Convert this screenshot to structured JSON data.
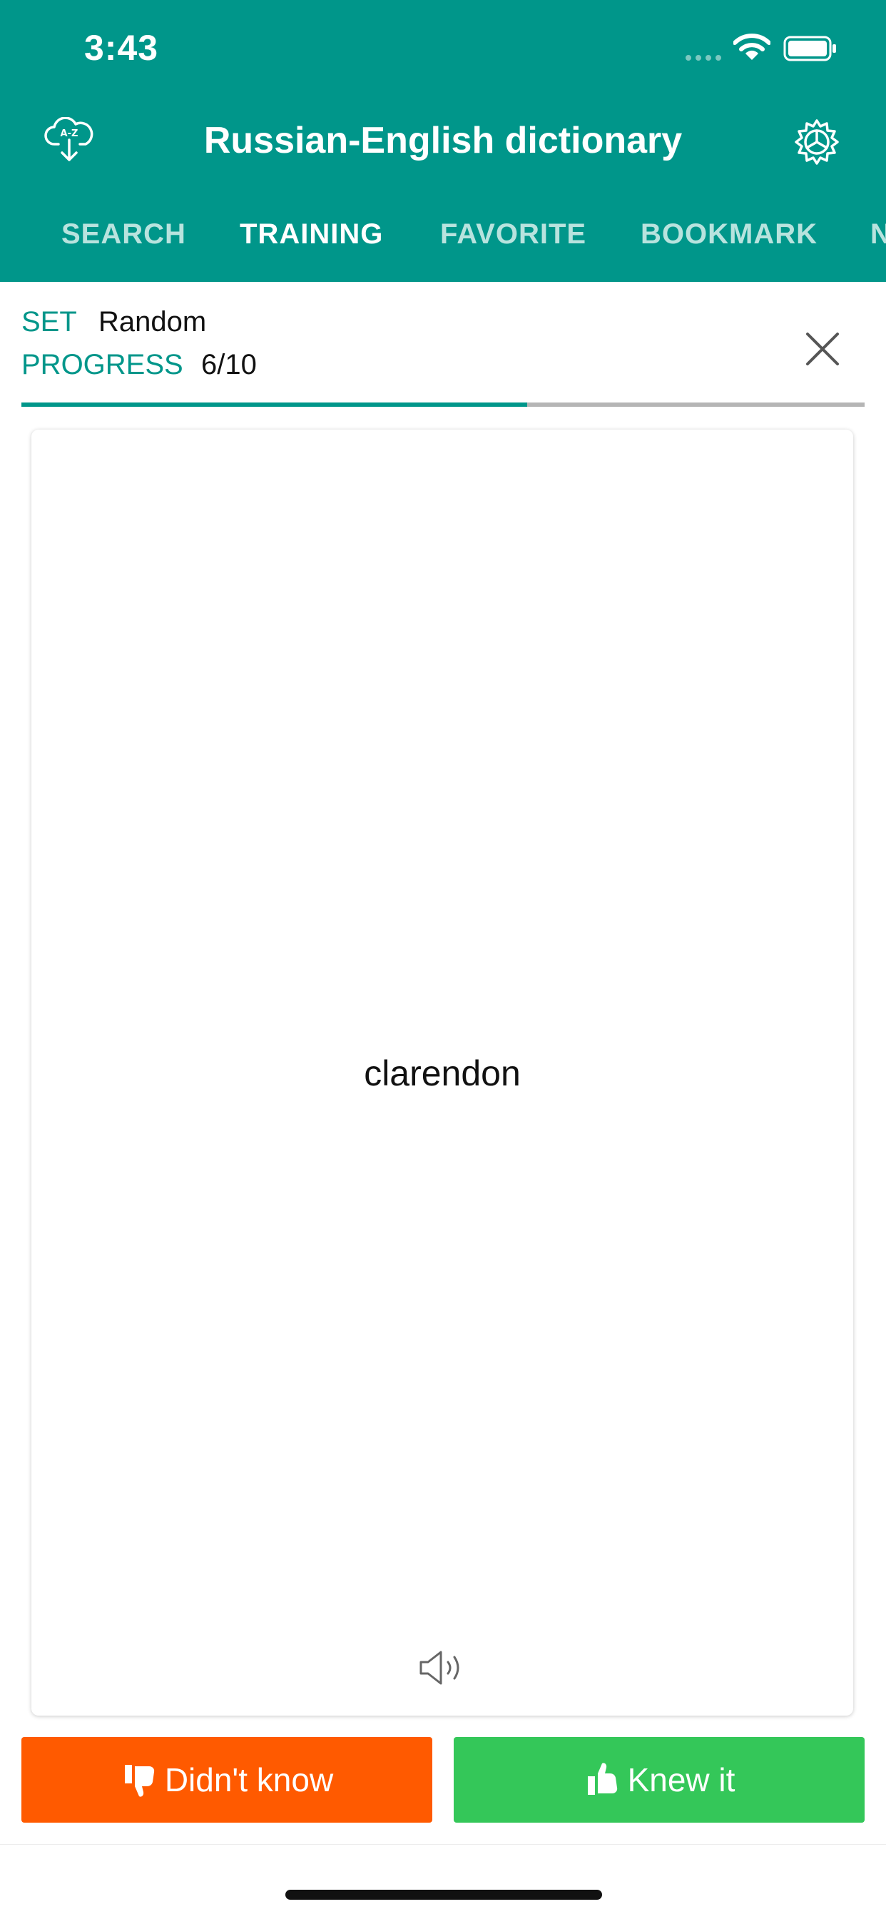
{
  "status_bar": {
    "time": "3:43"
  },
  "header": {
    "title": "Russian-English dictionary",
    "download_icon": "cloud-download-icon",
    "download_icon_text": "A-Z",
    "settings_icon": "gear-icon"
  },
  "tabs": [
    {
      "label": "SEARCH",
      "active": false
    },
    {
      "label": "TRAINING",
      "active": true
    },
    {
      "label": "FAVORITE",
      "active": false
    },
    {
      "label": "BOOKMARK",
      "active": false
    },
    {
      "label": "N",
      "active": false
    }
  ],
  "training": {
    "set_label": "SET",
    "set_value": "Random",
    "progress_label": "PROGRESS",
    "progress_value": "6/10",
    "progress_fraction": 0.6
  },
  "card": {
    "word": "clarendon",
    "speaker_icon": "speaker-icon"
  },
  "actions": {
    "didnt_know_label": "Didn't know",
    "knew_it_label": "Knew it"
  },
  "colors": {
    "header_bg": "#00968a",
    "accent": "#00968a",
    "didnt_know_bg": "#ff5a00",
    "knew_it_bg": "#34c759"
  }
}
